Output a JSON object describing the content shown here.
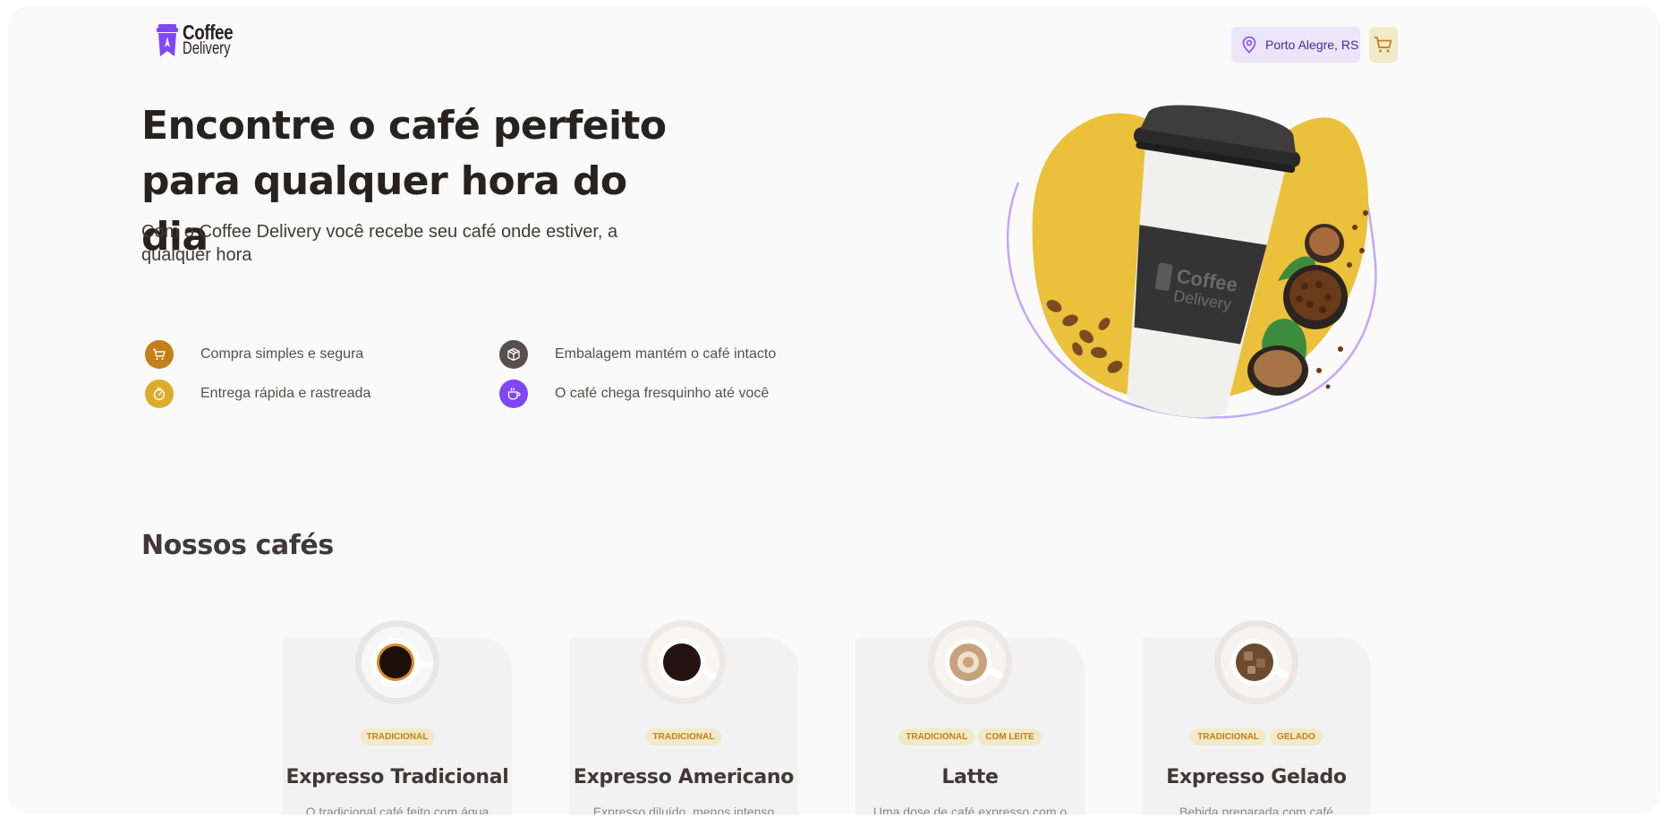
{
  "header": {
    "logo_line1": "Coffee",
    "logo_line2": "Delivery",
    "location": "Porto Alegre, RS"
  },
  "hero": {
    "title_line1": "Encontre o café perfeito",
    "title_line2": "para qualquer hora do dia",
    "subtitle": "Com o Coffee Delivery você recebe seu café onde estiver, a qualquer hora",
    "cup_brand_line1": "Coffee",
    "cup_brand_line2": "Delivery",
    "benefits": [
      {
        "label": "Compra simples e segura",
        "icon": "cart-icon",
        "color": "#c47f17"
      },
      {
        "label": "Embalagem mantém o café intacto",
        "icon": "package-icon",
        "color": "#574f4d"
      },
      {
        "label": "Entrega rápida e rastreada",
        "icon": "timer-icon",
        "color": "#dbac2c"
      },
      {
        "label": "O café chega fresquinho até você",
        "icon": "coffee-icon",
        "color": "#8047f8"
      }
    ]
  },
  "coffees": {
    "title": "Nossos cafés",
    "items": [
      {
        "name": "Expresso Tradicional",
        "tags": [
          "Tradicional"
        ],
        "description": "O tradicional café feito com água"
      },
      {
        "name": "Expresso Americano",
        "tags": [
          "Tradicional"
        ],
        "description": "Expresso diluído, menos intenso que o"
      },
      {
        "name": "Latte",
        "tags": [
          "Tradicional",
          "Com leite"
        ],
        "description": "Uma dose de café expresso com o"
      },
      {
        "name": "Expresso Gelado",
        "tags": [
          "Tradicional",
          "Gelado"
        ],
        "description": "Bebida preparada com café expresso e"
      }
    ]
  },
  "colors": {
    "yellow_dark": "#c47f17",
    "yellow": "#dbac2c",
    "yellow_light": "#f1e9c9",
    "purple_dark": "#4b2995",
    "purple": "#8047f8",
    "purple_light": "#ebe5f9",
    "background": "#fafafa"
  }
}
